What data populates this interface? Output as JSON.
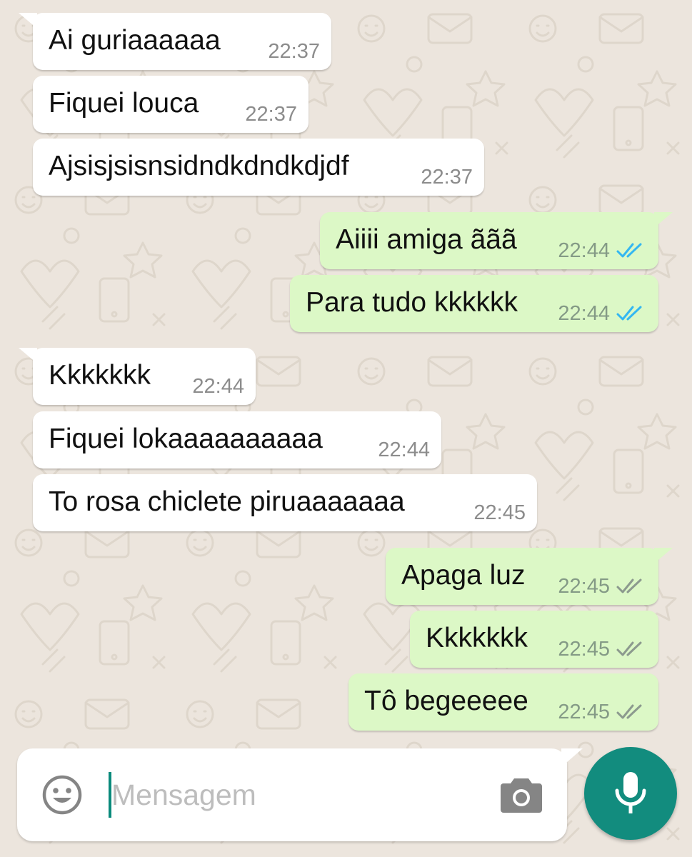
{
  "colors": {
    "background": "#ece5dd",
    "incoming_bubble": "#ffffff",
    "outgoing_bubble": "#dcf8c6",
    "read_tick": "#34b7f1",
    "delivered_tick": "#8c9a8e",
    "accent": "#128c7e"
  },
  "messages": [
    {
      "direction": "incoming",
      "text": "Ai guriaaaaaa",
      "time": "22:37"
    },
    {
      "direction": "incoming",
      "text": "Fiquei louca",
      "time": "22:37"
    },
    {
      "direction": "incoming",
      "text": "Ajsisjsisnsidndkdndkdjdf",
      "time": "22:37"
    },
    {
      "direction": "outgoing",
      "text": "Aiiii amiga ããã",
      "time": "22:44",
      "status": "read",
      "status_icon": "double-check-icon"
    },
    {
      "direction": "outgoing",
      "text": "Para tudo kkkkkk",
      "time": "22:44",
      "status": "read",
      "status_icon": "double-check-icon"
    },
    {
      "direction": "incoming",
      "text": "Kkkkkkk",
      "time": "22:44"
    },
    {
      "direction": "incoming",
      "text": "Fiquei lokaaaaaaaaaa",
      "time": "22:44"
    },
    {
      "direction": "incoming",
      "text": "To rosa chiclete piruaaaaaaa",
      "time": "22:45"
    },
    {
      "direction": "outgoing",
      "text": "Apaga luz",
      "time": "22:45",
      "status": "delivered",
      "status_icon": "double-check-icon"
    },
    {
      "direction": "outgoing",
      "text": "Kkkkkkk",
      "time": "22:45",
      "status": "delivered",
      "status_icon": "double-check-icon"
    },
    {
      "direction": "outgoing",
      "text": "Tô begeeeee",
      "time": "22:45",
      "status": "delivered",
      "status_icon": "double-check-icon"
    }
  ],
  "composer": {
    "placeholder": "Mensagem",
    "value": "",
    "emoji_icon": "smiley-icon",
    "camera_icon": "camera-icon",
    "send_icon": "microphone-icon"
  }
}
